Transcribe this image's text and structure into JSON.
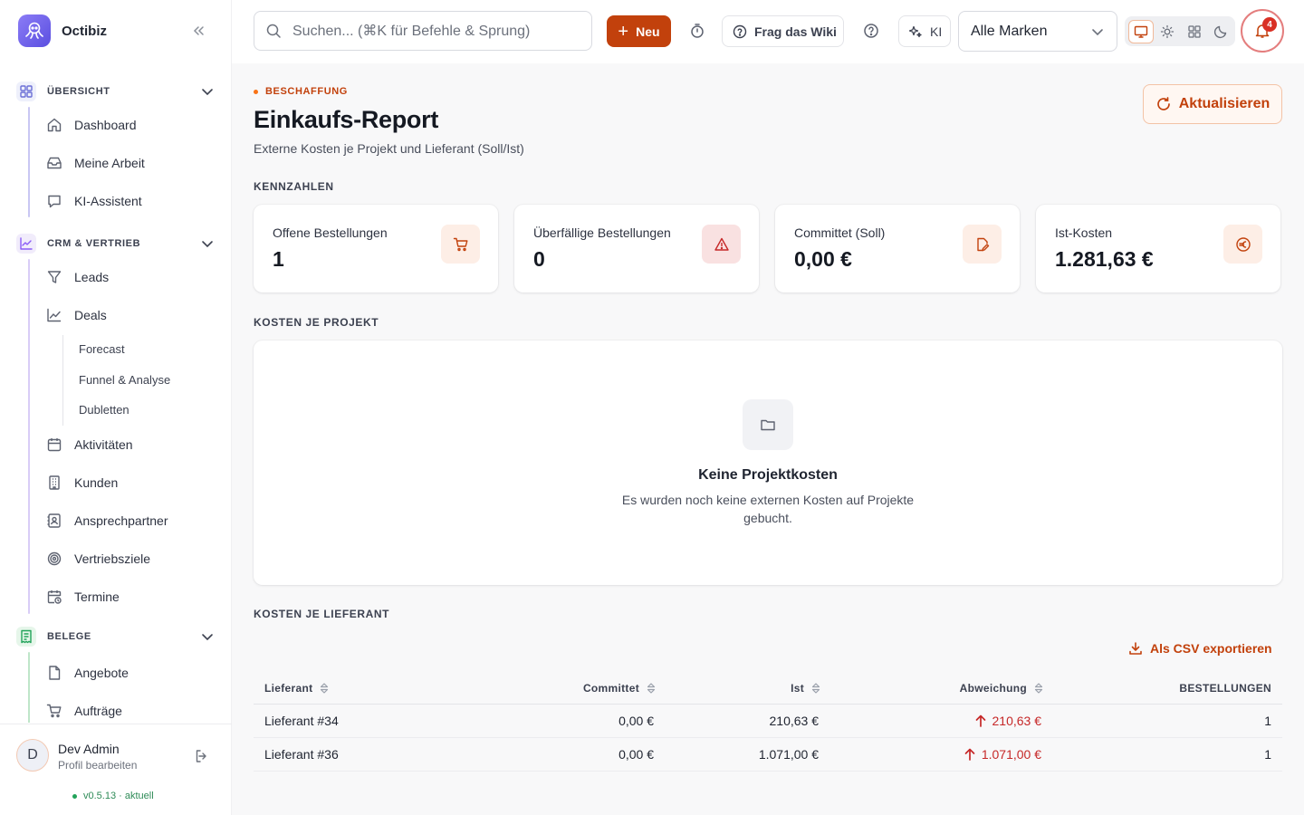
{
  "app": {
    "name": "Octibiz"
  },
  "sidebar": {
    "sections": [
      {
        "label": "ÜBERSICHT",
        "items": [
          "Dashboard",
          "Meine Arbeit",
          "KI-Assistent"
        ]
      },
      {
        "label": "CRM & VERTRIEB",
        "items": [
          "Leads",
          "Deals",
          "Aktivitäten",
          "Kunden",
          "Ansprechpartner",
          "Vertriebsziele",
          "Termine"
        ],
        "deal_subitems": [
          "Forecast",
          "Funnel & Analyse",
          "Dubletten"
        ]
      },
      {
        "label": "BELEGE",
        "items": [
          "Angebote",
          "Aufträge"
        ]
      }
    ]
  },
  "profile": {
    "initial": "D",
    "name": "Dev Admin",
    "sub": "Profil bearbeiten",
    "version": "v0.5.13 · aktuell"
  },
  "topbar": {
    "search_placeholder": "Suchen... (⌘K für Befehle & Sprung)",
    "new_label": "Neu",
    "wiki_label": "Frag das Wiki",
    "ai_label": "KI",
    "brand_select": "Alle Marken",
    "notification_count": "4"
  },
  "page": {
    "eyebrow": "BESCHAFFUNG",
    "title": "Einkaufs-Report",
    "subtitle": "Externe Kosten je Projekt und Lieferant (Soll/Ist)",
    "refresh_label": "Aktualisieren"
  },
  "kpis": {
    "section_title": "KENNZAHLEN",
    "cards": [
      {
        "label": "Offene Bestellungen",
        "value": "1"
      },
      {
        "label": "Überfällige Bestellungen",
        "value": "0"
      },
      {
        "label": "Committet (Soll)",
        "value": "0,00 €"
      },
      {
        "label": "Ist-Kosten",
        "value": "1.281,63 €"
      }
    ]
  },
  "projects": {
    "section_title": "KOSTEN JE PROJEKT",
    "empty_title": "Keine Projektkosten",
    "empty_desc": "Es wurden noch keine externen Kosten auf Projekte gebucht."
  },
  "suppliers": {
    "section_title": "KOSTEN JE LIEFERANT",
    "export_label": "Als CSV exportieren",
    "columns": [
      "Lieferant",
      "Committet",
      "Ist",
      "Abweichung",
      "BESTELLUNGEN"
    ],
    "rows": [
      {
        "supplier": "Lieferant #34",
        "committed": "0,00 €",
        "actual": "210,63 €",
        "deviation": "210,63 €",
        "orders": "1"
      },
      {
        "supplier": "Lieferant #36",
        "committed": "0,00 €",
        "actual": "1.071,00 €",
        "deviation": "1.071,00 €",
        "orders": "1"
      }
    ]
  },
  "colors": {
    "accent": "#c2410c",
    "negative": "#c62828",
    "success": "#22a35a"
  }
}
